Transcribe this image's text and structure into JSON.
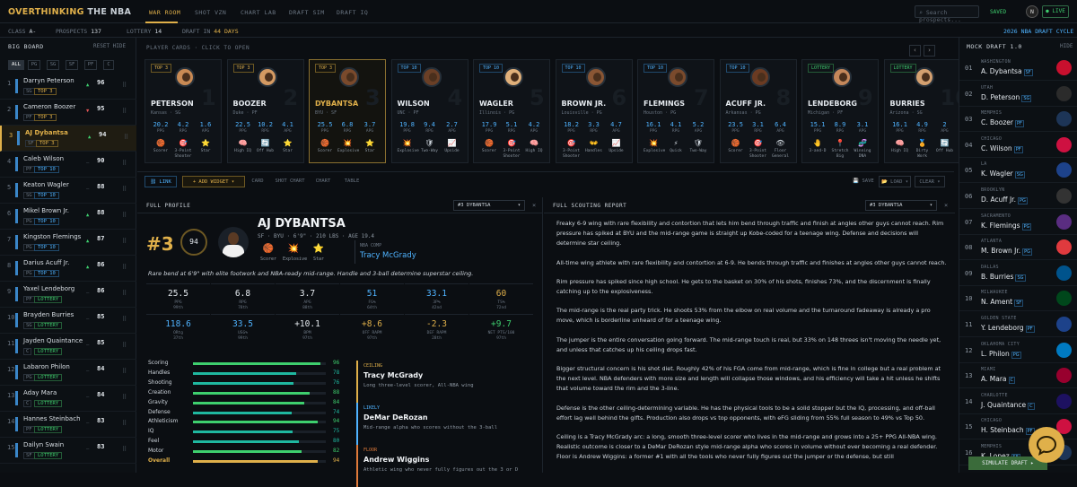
{
  "brand": {
    "part1": "OVERTHINKING",
    "part2": "THE NBA"
  },
  "nav": [
    "WAR ROOM",
    "SHOT VZN",
    "CHART LAB",
    "DRAFT SIM",
    "DRAFT IQ"
  ],
  "search_placeholder": "Search prospects...",
  "saved": "SAVED",
  "avatar": "N",
  "live": "LIVE",
  "subbar": {
    "class_label": "CLASS",
    "class_value": "A-",
    "prospects_label": "PROSPECTS",
    "prospects_value": "137",
    "lottery_label": "LOTTERY",
    "lottery_value": "14",
    "draft_prefix": "DRAFT IN",
    "draft_days": "44 DAYS",
    "cycle": "2026 NBA DRAFT CYCLE"
  },
  "board": {
    "title": "BIG BOARD",
    "actions": "RESET HIDE",
    "filters": [
      "ALL",
      "PG",
      "SG",
      "SF",
      "PF",
      "C"
    ],
    "rows": [
      {
        "rank": "1",
        "name": "Darryn Peterson",
        "pos": "SG",
        "tag": "TOP 3",
        "arrow": "▲",
        "score": "96"
      },
      {
        "rank": "2",
        "name": "Cameron Boozer",
        "pos": "PF",
        "tag": "TOP 3",
        "arrow": "▼",
        "score": "95"
      },
      {
        "rank": "3",
        "name": "AJ Dybantsa",
        "pos": "SF",
        "tag": "TOP 3",
        "arrow": "▲",
        "score": "94"
      },
      {
        "rank": "4",
        "name": "Caleb Wilson",
        "pos": "PF",
        "tag": "TOP 10",
        "arrow": "—",
        "score": "90"
      },
      {
        "rank": "5",
        "name": "Keaton Wagler",
        "pos": "SG",
        "tag": "TOP 10",
        "arrow": "—",
        "score": "88"
      },
      {
        "rank": "6",
        "name": "Mikel Brown Jr.",
        "pos": "PG",
        "tag": "TOP 10",
        "arrow": "▲",
        "score": "88"
      },
      {
        "rank": "7",
        "name": "Kingston Flemings",
        "pos": "PG",
        "tag": "TOP 10",
        "arrow": "▲",
        "score": "87"
      },
      {
        "rank": "8",
        "name": "Darius Acuff Jr.",
        "pos": "PG",
        "tag": "TOP 10",
        "arrow": "▲",
        "score": "86"
      },
      {
        "rank": "9",
        "name": "Yaxel Lendeborg",
        "pos": "PF",
        "tag": "LOTTERY",
        "arrow": "—",
        "score": "86"
      },
      {
        "rank": "10",
        "name": "Brayden Burries",
        "pos": "SG",
        "tag": "LOTTERY",
        "arrow": "—",
        "score": "85"
      },
      {
        "rank": "11",
        "name": "Jayden Quaintance",
        "pos": "C",
        "tag": "LOTTERY",
        "arrow": "—",
        "score": "85"
      },
      {
        "rank": "12",
        "name": "Labaron Philon",
        "pos": "PG",
        "tag": "LOTTERY",
        "arrow": "—",
        "score": "84"
      },
      {
        "rank": "13",
        "name": "Aday Mara",
        "pos": "C",
        "tag": "LOTTERY",
        "arrow": "—",
        "score": "84"
      },
      {
        "rank": "14",
        "name": "Hannes Steinbach",
        "pos": "PF",
        "tag": "LOTTERY",
        "arrow": "—",
        "score": "83"
      },
      {
        "rank": "15",
        "name": "Dailyn Swain",
        "pos": "SF",
        "tag": "LOTTERY",
        "arrow": "—",
        "score": "83"
      }
    ]
  },
  "cards": {
    "label": "PLAYER CARDS · CLICK TO OPEN",
    "stat_labels": [
      "PPG",
      "RPG",
      "APG"
    ],
    "items": [
      {
        "tag": "TOP 3",
        "name": "PETERSON",
        "school": "Kansas · SG",
        "num": "1",
        "stats": [
          "20.2",
          "4.2",
          "1.6"
        ],
        "icons": [
          "🏀",
          "🎯",
          "⭐"
        ],
        "icon_labels": [
          "Scorer",
          "3-Point Shooter",
          "Star"
        ]
      },
      {
        "tag": "TOP 3",
        "name": "BOOZER",
        "school": "Duke · PF",
        "num": "2",
        "stats": [
          "22.5",
          "10.2",
          "4.1"
        ],
        "icons": [
          "🧠",
          "🔄",
          "⭐"
        ],
        "icon_labels": [
          "High IQ",
          "Off Hub",
          "Star"
        ]
      },
      {
        "tag": "TOP 3",
        "name": "DYBANTSA",
        "school": "BYU · SF",
        "num": "3",
        "stats": [
          "25.5",
          "6.8",
          "3.7"
        ],
        "icons": [
          "🏀",
          "💥",
          "⭐"
        ],
        "icon_labels": [
          "Scorer",
          "Explosive",
          "Star"
        ]
      },
      {
        "tag": "TOP 10",
        "name": "WILSON",
        "school": "UNC · PF",
        "num": "4",
        "stats": [
          "19.8",
          "9.4",
          "2.7"
        ],
        "icons": [
          "💥",
          "🛡",
          "📈"
        ],
        "icon_labels": [
          "Explosive",
          "Two-Way",
          "Upside"
        ]
      },
      {
        "tag": "TOP 10",
        "name": "WAGLER",
        "school": "Illinois · PG",
        "num": "5",
        "stats": [
          "17.9",
          "5.1",
          "4.2"
        ],
        "icons": [
          "🏀",
          "🎯",
          "🧠"
        ],
        "icon_labels": [
          "Scorer",
          "3-Point Shooter",
          "High IQ"
        ]
      },
      {
        "tag": "TOP 10",
        "name": "BROWN JR.",
        "school": "Louisville · PG",
        "num": "6",
        "stats": [
          "18.2",
          "3.3",
          "4.7"
        ],
        "icons": [
          "🎯",
          "👐",
          "📈"
        ],
        "icon_labels": [
          "3-Point Shooter",
          "Handles",
          "Upside"
        ]
      },
      {
        "tag": "TOP 10",
        "name": "FLEMINGS",
        "school": "Houston · PG",
        "num": "7",
        "stats": [
          "16.1",
          "4.1",
          "5.2"
        ],
        "icons": [
          "💥",
          "⚡",
          "🛡"
        ],
        "icon_labels": [
          "Explosive",
          "Quick",
          "Two-Way"
        ]
      },
      {
        "tag": "TOP 10",
        "name": "ACUFF JR.",
        "school": "Arkansas · PG",
        "num": "8",
        "stats": [
          "23.5",
          "3.1",
          "6.4"
        ],
        "icons": [
          "🏀",
          "🎯",
          "👁"
        ],
        "icon_labels": [
          "Scorer",
          "3-Point Shooter",
          "Floor General"
        ]
      },
      {
        "tag": "LOTTERY",
        "name": "LENDEBORG",
        "school": "Michigan · PF",
        "num": "9",
        "stats": [
          "15.1",
          "8.9",
          "3.1"
        ],
        "icons": [
          "🤚",
          "📍",
          "🧬"
        ],
        "icon_labels": [
          "3-and-D",
          "Stretch Big",
          "Winning DNA"
        ]
      },
      {
        "tag": "LOTTERY",
        "name": "BURRIES",
        "school": "Arizona · SG",
        "num": "10",
        "stats": [
          "16.1",
          "4.9",
          "2"
        ],
        "icons": [
          "🧠",
          "🏅",
          "🔄"
        ],
        "icon_labels": [
          "High IQ",
          "Dirty Work",
          "Off Hub"
        ]
      }
    ]
  },
  "toolbar": {
    "link": "⛓ LINK",
    "add": "+ ADD WIDGET ▾",
    "tabs": [
      "CARD",
      "SHOT CHART",
      "CHART",
      "TABLE"
    ],
    "save": "💾 SAVE",
    "load": "📂 LOAD ▾",
    "clear": "CLEAR ▾"
  },
  "profile": {
    "title": "FULL PROFILE",
    "select": "#3 DYBANTSA",
    "rank": "#3",
    "score": "94",
    "name": "AJ DYBANTSA",
    "meta": "SF · BYU · 6'9\" · 210 LBS · AGE 19.4",
    "badges": [
      {
        "icon": "🏀",
        "label": "Scorer"
      },
      {
        "icon": "💥",
        "label": "Explosive"
      },
      {
        "icon": "⭐",
        "label": "Star"
      }
    ],
    "comp_label": "NBA COMP",
    "comp": "Tracy McGrady",
    "desc": "Rare bend at 6'9\" with elite footwork and NBA-ready mid-range. Handle and 3-ball determine superstar ceiling.",
    "stats": [
      {
        "v": "25.5",
        "l": "PPG",
        "p": "99th",
        "c": "#e5eaef"
      },
      {
        "v": "6.8",
        "l": "RPG",
        "p": "78th",
        "c": "#e5eaef"
      },
      {
        "v": "3.7",
        "l": "APG",
        "p": "88th",
        "c": "#e5eaef"
      },
      {
        "v": "51",
        "l": "FG%",
        "p": "64th",
        "c": "#4fb3ff"
      },
      {
        "v": "33.1",
        "l": "3P%",
        "p": "42nd",
        "c": "#4fb3ff"
      },
      {
        "v": "60",
        "l": "TS%",
        "p": "72nd",
        "c": "#e0b04a"
      },
      {
        "v": "118.6",
        "l": "ORtg",
        "p": "37th",
        "c": "#4fb3ff"
      },
      {
        "v": "33.5",
        "l": "USG%",
        "p": "99th",
        "c": "#4fb3ff"
      },
      {
        "v": "+10.1",
        "l": "BPM",
        "p": "97th",
        "c": "#e5eaef"
      },
      {
        "v": "+8.6",
        "l": "OFF RAPM",
        "p": "97th",
        "c": "#e0b04a"
      },
      {
        "v": "-2.3",
        "l": "DEF RAPM",
        "p": "28th",
        "c": "#e0b04a"
      },
      {
        "v": "+9.7",
        "l": "NET PTS/100",
        "p": "97th",
        "c": "#3ecf6e"
      }
    ],
    "attributes": [
      {
        "name": "Scoring",
        "value": 96,
        "color": "#3ecf6e"
      },
      {
        "name": "Handles",
        "value": 78,
        "color": "#1fb8a0"
      },
      {
        "name": "Shooting",
        "value": 76,
        "color": "#1fb8a0"
      },
      {
        "name": "Creation",
        "value": 88,
        "color": "#3ecf6e"
      },
      {
        "name": "Gravity",
        "value": 84,
        "color": "#3ecf6e"
      },
      {
        "name": "Defense",
        "value": 74,
        "color": "#1fb8a0"
      },
      {
        "name": "Athleticism",
        "value": 94,
        "color": "#3ecf6e"
      },
      {
        "name": "IQ",
        "value": 75,
        "color": "#1fb8a0"
      },
      {
        "name": "Feel",
        "value": 80,
        "color": "#1fb8a0"
      },
      {
        "name": "Motor",
        "value": 82,
        "color": "#3ecf6e"
      },
      {
        "name": "Overall",
        "value": 94,
        "color": "#e0b04a"
      }
    ],
    "comps": [
      {
        "label": "CEILING",
        "name": "Tracy McGrady",
        "desc": "Long three-level scorer, All-NBA wing",
        "color": "#e0b04a"
      },
      {
        "label": "LIKELY",
        "name": "DeMar DeRozan",
        "desc": "Mid-range alpha who scores without the 3-ball",
        "color": "#4fb3ff"
      },
      {
        "label": "FLOOR",
        "name": "Andrew Wiggins",
        "desc": "Athletic wing who never fully figures out the 3 or D",
        "color": "#e07a3a"
      }
    ]
  },
  "report": {
    "title": "FULL SCOUTING REPORT",
    "select": "#3 DYBANTSA",
    "paragraphs": [
      "Freaky 6-9 wing with rare flexibility and contortion that lets him bend through traffic and finish at angles other guys cannot reach. Rim pressure has spiked at BYU and the mid-range game is straight up Kobe-coded for a teenage wing. Defense and decisions will determine star ceiling.",
      "All-time wing athlete with rare flexibility and contortion at 6-9. He bends through traffic and finishes at angles other guys cannot reach.",
      "Rim pressure has spiked since high school. He gets to the basket on 30% of his shots, finishes 73%, and the discernment is finally catching up to the explosiveness.",
      "The mid-range is the real party trick. He shoots 53% from the elbow on real volume and the turnaround fadeaway is already a pro move, which is borderline unheard of for a teenage wing.",
      "The jumper is the entire conversation going forward. The mid-range touch is real, but 33% on 148 threes isn't moving the needle yet, and unless that catches up his ceiling drops fast.",
      "Bigger structural concern is his shot diet. Roughly 42% of his FGA come from mid-range, which is fine in college but a real problem at the next level. NBA defenders with more size and length will collapse those windows, and his efficiency will take a hit unless he shifts that volume toward the rim and the 3-line.",
      "Defense is the other ceiling-determining variable. He has the physical tools to be a solid stopper but the IQ, processing, and off-ball effort lag well behind the gifts. Production also drops vs top opponents, with eFG sliding from 55% full season to 49% vs Top 50.",
      "Ceiling is a Tracy McGrady arc: a long, smooth three-level scorer who lives in the mid-range and grows into a 25+ PPG All-NBA wing. Realistic outcome is closer to a DeMar DeRozan style mid-range alpha who scores in volume without ever becoming a real defender. Floor is Andrew Wiggins: a former #1 with all the tools who never fully figures out the jumper or the defense, but still"
    ]
  },
  "mock": {
    "title": "MOCK DRAFT 1.0",
    "hide": "HIDE",
    "sim": "SIMULATE DRAFT ▸",
    "picks": [
      {
        "n": "01",
        "team": "WASHINGTON",
        "name": "A. Dybantsa",
        "pos": "SF",
        "color": "#c8102e"
      },
      {
        "n": "02",
        "team": "UTAH",
        "name": "D. Peterson",
        "pos": "SG",
        "color": "#2b2b2b"
      },
      {
        "n": "03",
        "team": "MEMPHIS",
        "name": "C. Boozer",
        "pos": "PF",
        "color": "#1d3557"
      },
      {
        "n": "04",
        "team": "CHICAGO",
        "name": "C. Wilson",
        "pos": "PF",
        "color": "#ce1141"
      },
      {
        "n": "05",
        "team": "LA",
        "name": "K. Wagler",
        "pos": "SG",
        "color": "#1d428a"
      },
      {
        "n": "06",
        "team": "BROOKLYN",
        "name": "D. Acuff Jr.",
        "pos": "PG",
        "color": "#333333"
      },
      {
        "n": "07",
        "team": "SACRAMENTO",
        "name": "K. Flemings",
        "pos": "PG",
        "color": "#5a2d81"
      },
      {
        "n": "08",
        "team": "ATLANTA",
        "name": "M. Brown Jr.",
        "pos": "PG",
        "color": "#e03a3e"
      },
      {
        "n": "09",
        "team": "DALLAS",
        "name": "B. Burries",
        "pos": "SG",
        "color": "#00538c"
      },
      {
        "n": "10",
        "team": "MILWAUKEE",
        "name": "N. Ament",
        "pos": "SF",
        "color": "#00471b"
      },
      {
        "n": "11",
        "team": "GOLDEN STATE",
        "name": "Y. Lendeborg",
        "pos": "PF",
        "color": "#1d428a"
      },
      {
        "n": "12",
        "team": "OKLAHOMA CITY",
        "name": "L. Philon",
        "pos": "PG",
        "color": "#007ac1"
      },
      {
        "n": "13",
        "team": "MIAMI",
        "name": "A. Mara",
        "pos": "C",
        "color": "#98002e"
      },
      {
        "n": "14",
        "team": "CHARLOTTE",
        "name": "J. Quaintance",
        "pos": "C",
        "color": "#1d1160"
      },
      {
        "n": "15",
        "team": "CHICAGO",
        "name": "H. Steinbach",
        "pos": "PF",
        "color": "#ce1141"
      },
      {
        "n": "16",
        "team": "MEMPHIS",
        "name": "K. Lopez",
        "pos": "SF",
        "color": "#1d3557"
      }
    ]
  }
}
